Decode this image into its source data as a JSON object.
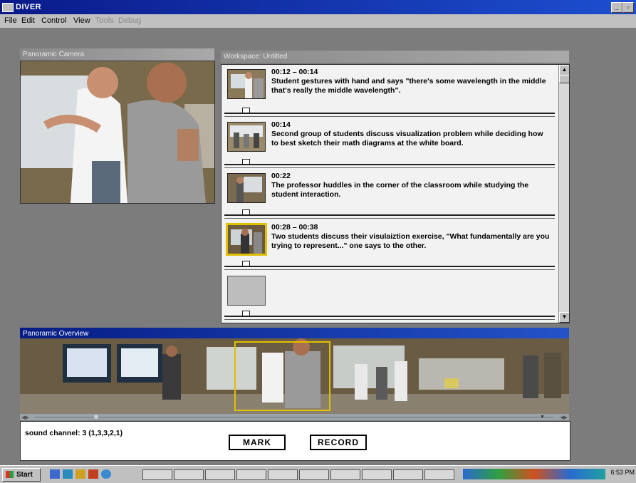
{
  "window": {
    "title": "DIVER"
  },
  "menu": {
    "items": [
      "File",
      "Edit",
      "Control",
      "View"
    ],
    "disabled": [
      "Tools",
      "Debug"
    ]
  },
  "camera": {
    "title": "Panoramic Camera"
  },
  "workspace": {
    "title": "Workspace: Untitled",
    "entries": [
      {
        "time": "00:12 – 00:14",
        "text": "Student gestures with hand and says \"there's some wavelength in the middle that's really the middle wavelength\"."
      },
      {
        "time": "00:14",
        "text": "Second group of students discuss visualization problem while deciding how to best sketch their math diagrams at the white board."
      },
      {
        "time": "00:22",
        "text": "The professor huddles in the corner of the classroom while studying the student interaction."
      },
      {
        "time": "00:28 – 00:38",
        "text": "Two students discuss their visulaiztion exercise, \"What fundamentally are you trying to represent...\" one says to the other."
      },
      {
        "time": "",
        "text": ""
      }
    ]
  },
  "overview": {
    "title": "Panoramic Overview"
  },
  "bottom": {
    "sound_label": "sound channel: 3 (1,3,3,2,1)",
    "mark_label": "MARK",
    "record_label": "RECORD"
  },
  "taskbar": {
    "start_label": "Start",
    "clock": "6:53 PM"
  },
  "colors": {
    "titlebar": "#0a1a8a",
    "selection": "#e0c000",
    "desktop": "#7c7c7c"
  }
}
